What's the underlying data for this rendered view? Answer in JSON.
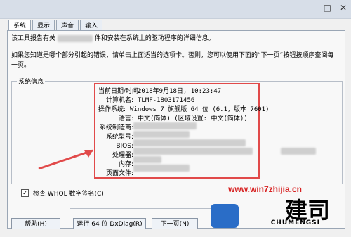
{
  "window": {
    "controls": [
      "—",
      "□",
      "✕"
    ]
  },
  "tabs": [
    {
      "label": "系统"
    },
    {
      "label": "显示"
    },
    {
      "label": "声音"
    },
    {
      "label": "输入"
    }
  ],
  "intro": {
    "line1_prefix": "该工具报告有关",
    "line1_suffix": "件和安装在系统上的驱动程序的详细信息。",
    "line2": "如果您知道是哪个部分引起的错误，请单击上面适当的选项卡。否则，您可以使用下面的“下一页”按钮按顺序查阅每一页。"
  },
  "system_info": {
    "title": "系统信息",
    "rows": [
      {
        "key": "当前日期/时间:",
        "value": "2018年9月18日, 10:23:47"
      },
      {
        "key": "计算机名:",
        "value": "TLMF-1803171456"
      },
      {
        "key": "操作系统:",
        "value": "Windows 7 旗舰版 64 位 (6.1，版本 7601)"
      },
      {
        "key": "语言:",
        "value": "中文(简体) (区域设置: 中文(简体))"
      },
      {
        "key": "系统制造商:",
        "value": ""
      },
      {
        "key": "系统型号:",
        "value": ""
      },
      {
        "key": "BIOS:",
        "value": ""
      },
      {
        "key": "处理器:",
        "value": ""
      },
      {
        "key": "内存:",
        "value": ""
      },
      {
        "key": "页面文件:",
        "value": ""
      }
    ]
  },
  "checkbox": {
    "label": "检查 WHQL 数字签名(C)"
  },
  "buttons": {
    "help": "帮助(H)",
    "run64": "运行 64 位 DxDiag(R)",
    "next": "下一页(N)"
  },
  "watermark": {
    "text": "www.win7zhijia.cn"
  },
  "logo": {
    "main": "建司",
    "sub": "CHUMENGSI"
  },
  "colors": {
    "red": "#e14a4a",
    "watermark": "#d72020"
  }
}
